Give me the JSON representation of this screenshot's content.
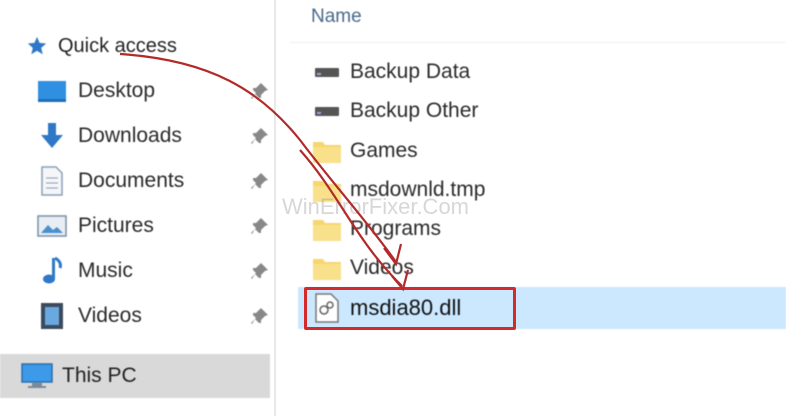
{
  "sidebar": {
    "quick_access": "Quick access",
    "items": [
      {
        "label": "Desktop",
        "icon": "desktop-icon",
        "pinned": true
      },
      {
        "label": "Downloads",
        "icon": "downloads-icon",
        "pinned": true
      },
      {
        "label": "Documents",
        "icon": "documents-icon",
        "pinned": true
      },
      {
        "label": "Pictures",
        "icon": "pictures-icon",
        "pinned": true
      },
      {
        "label": "Music",
        "icon": "music-icon",
        "pinned": true
      },
      {
        "label": "Videos",
        "icon": "videos-icon",
        "pinned": true
      }
    ],
    "this_pc": "This PC"
  },
  "main": {
    "column_name": "Name",
    "files": [
      {
        "name": "Backup Data",
        "icon": "drive-icon"
      },
      {
        "name": "Backup Other",
        "icon": "drive-icon"
      },
      {
        "name": "Games",
        "icon": "folder-icon"
      },
      {
        "name": "msdownld.tmp",
        "icon": "folder-icon"
      },
      {
        "name": "Programs",
        "icon": "folder-icon"
      },
      {
        "name": "Videos",
        "icon": "folder-icon"
      }
    ],
    "selected_file": {
      "name": "msdia80.dll",
      "icon": "dll-file-icon"
    }
  },
  "watermark": "WinErrorFixer.Com",
  "colors": {
    "selection": "#cce8ff",
    "highlight": "#d42a2a",
    "folder": "#f6d66e",
    "this_pc_bg": "#d9d9d9"
  }
}
